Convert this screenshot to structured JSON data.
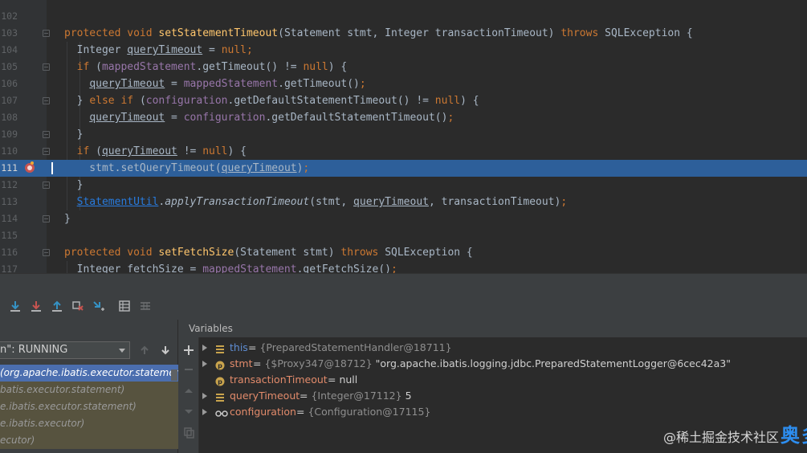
{
  "editor": {
    "lines": [
      {
        "num": "102",
        "tokens": []
      },
      {
        "num": "103",
        "tokens": [
          {
            "t": "protected void ",
            "c": "kw"
          },
          {
            "t": "setStatementTimeout",
            "c": "fn"
          },
          {
            "t": "(Statement stmt, Integer transactionTimeout) ",
            "c": "pl"
          },
          {
            "t": "throws ",
            "c": "kw"
          },
          {
            "t": "SQLException {",
            "c": "pl"
          }
        ]
      },
      {
        "num": "104",
        "tokens": [
          {
            "t": "  Integer ",
            "c": "pl"
          },
          {
            "t": "queryTimeout",
            "c": "var"
          },
          {
            "t": " = ",
            "c": "pl"
          },
          {
            "t": "null",
            "c": "kw"
          },
          {
            "t": ";",
            "c": "kw"
          }
        ]
      },
      {
        "num": "105",
        "tokens": [
          {
            "t": "  ",
            "c": "pl"
          },
          {
            "t": "if ",
            "c": "kw"
          },
          {
            "t": "(",
            "c": "pl"
          },
          {
            "t": "mappedStatement",
            "c": "fld"
          },
          {
            "t": ".getTimeout() != ",
            "c": "pl"
          },
          {
            "t": "null",
            "c": "kw"
          },
          {
            "t": ") {",
            "c": "pl"
          }
        ]
      },
      {
        "num": "106",
        "tokens": [
          {
            "t": "    ",
            "c": "pl"
          },
          {
            "t": "queryTimeout",
            "c": "var"
          },
          {
            "t": " = ",
            "c": "pl"
          },
          {
            "t": "mappedStatement",
            "c": "fld"
          },
          {
            "t": ".getTimeout()",
            "c": "pl"
          },
          {
            "t": ";",
            "c": "kw"
          }
        ]
      },
      {
        "num": "107",
        "tokens": [
          {
            "t": "  } ",
            "c": "pl"
          },
          {
            "t": "else if ",
            "c": "kw"
          },
          {
            "t": "(",
            "c": "pl"
          },
          {
            "t": "configuration",
            "c": "fld"
          },
          {
            "t": ".getDefaultStatementTimeout() != ",
            "c": "pl"
          },
          {
            "t": "null",
            "c": "kw"
          },
          {
            "t": ") {",
            "c": "pl"
          }
        ]
      },
      {
        "num": "108",
        "tokens": [
          {
            "t": "    ",
            "c": "pl"
          },
          {
            "t": "queryTimeout",
            "c": "var"
          },
          {
            "t": " = ",
            "c": "pl"
          },
          {
            "t": "configuration",
            "c": "fld"
          },
          {
            "t": ".getDefaultStatementTimeout()",
            "c": "pl"
          },
          {
            "t": ";",
            "c": "kw"
          }
        ]
      },
      {
        "num": "109",
        "tokens": [
          {
            "t": "  }",
            "c": "pl"
          }
        ]
      },
      {
        "num": "110",
        "tokens": [
          {
            "t": "  ",
            "c": "pl"
          },
          {
            "t": "if ",
            "c": "kw"
          },
          {
            "t": "(",
            "c": "pl"
          },
          {
            "t": "queryTimeout",
            "c": "var"
          },
          {
            "t": " != ",
            "c": "pl"
          },
          {
            "t": "null",
            "c": "kw"
          },
          {
            "t": ") {",
            "c": "pl"
          }
        ]
      },
      {
        "num": "111",
        "current": true,
        "tokens": [
          {
            "t": "    stmt.setQueryTimeout(",
            "c": "pl"
          },
          {
            "t": "queryTimeout",
            "c": "var"
          },
          {
            "t": ")",
            "c": "pl"
          },
          {
            "t": ";",
            "c": "kw"
          }
        ]
      },
      {
        "num": "112",
        "tokens": [
          {
            "t": "  }",
            "c": "pl"
          }
        ]
      },
      {
        "num": "113",
        "tokens": [
          {
            "t": "  ",
            "c": "pl"
          },
          {
            "t": "StatementUtil",
            "c": "cls"
          },
          {
            "t": ".",
            "c": "pl"
          },
          {
            "t": "applyTransactionTimeout",
            "c": "stat"
          },
          {
            "t": "(stmt, ",
            "c": "pl"
          },
          {
            "t": "queryTimeout",
            "c": "var"
          },
          {
            "t": ", transactionTimeout)",
            "c": "pl"
          },
          {
            "t": ";",
            "c": "kw"
          }
        ]
      },
      {
        "num": "114",
        "tokens": [
          {
            "t": "}",
            "c": "pl"
          }
        ]
      },
      {
        "num": "115",
        "tokens": []
      },
      {
        "num": "116",
        "tokens": [
          {
            "t": "protected void ",
            "c": "kw"
          },
          {
            "t": "setFetchSize",
            "c": "fn"
          },
          {
            "t": "(Statement stmt) ",
            "c": "pl"
          },
          {
            "t": "throws ",
            "c": "kw"
          },
          {
            "t": "SQLException {",
            "c": "pl"
          }
        ]
      },
      {
        "num": "117",
        "tokens": [
          {
            "t": "  Integer fetchSize = ",
            "c": "pl"
          },
          {
            "t": "mappedStatement",
            "c": "fld"
          },
          {
            "t": ".getFetchSize()",
            "c": "pl"
          },
          {
            "t": ";",
            "c": "kw"
          }
        ]
      }
    ]
  },
  "toolbar": {
    "buttons": [
      "step-over-icon",
      "step-into-icon",
      "force-step-into-icon",
      "step-out-icon",
      "drop-frame-icon",
      "run-to-cursor-icon",
      "evaluate-expression-icon",
      "trace-icon"
    ]
  },
  "frames": {
    "thread_label": "n\": RUNNING",
    "items": [
      "(org.apache.ibatis.executor.statement)",
      "batis.executor.statement)",
      "e.ibatis.executor.statement)",
      "e.ibatis.executor)",
      "ecutor)"
    ]
  },
  "variables": {
    "header": "Variables",
    "rows": [
      {
        "name": "this",
        "eq": " = ",
        "type": "{PreparedStatementHandler@18711}",
        "value": "",
        "icon": "field-icon",
        "expandable": true
      },
      {
        "name": "stmt",
        "eq": " = ",
        "type": "{$Proxy347@18712}",
        "value": " \"org.apache.ibatis.logging.jdbc.PreparedStatementLogger@6cec42a3\"",
        "icon": "parameter-icon",
        "expandable": true
      },
      {
        "name": "transactionTimeout",
        "eq": " = ",
        "type": "",
        "value": "null",
        "icon": "parameter-icon",
        "expandable": false
      },
      {
        "name": "queryTimeout",
        "eq": " = ",
        "type": "{Integer@17112}",
        "value": " 5",
        "icon": "field-icon",
        "expandable": true
      },
      {
        "name": "configuration",
        "eq": " = ",
        "type": "{Configuration@17115}",
        "value": "",
        "icon": "watch-icon",
        "expandable": true
      }
    ]
  },
  "watermark": {
    "prefix": "@稀土掘金技术社区",
    "brand": "奥多云"
  },
  "colors": {
    "current_line": "#2d5f9a",
    "selected_frame": "#4b6eaf",
    "breakpoint": "#c75450"
  }
}
